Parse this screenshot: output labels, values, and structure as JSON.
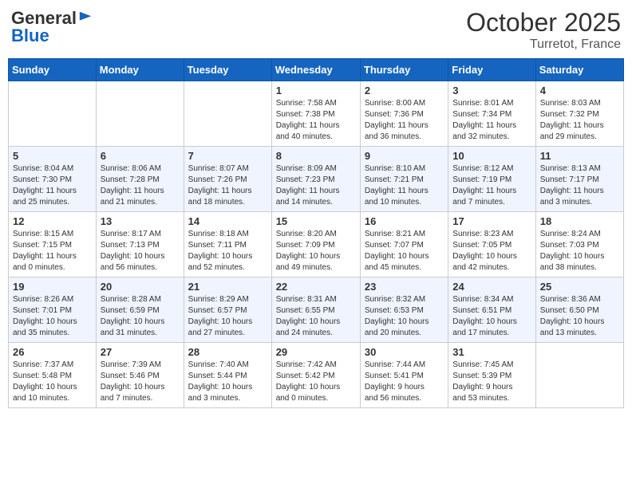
{
  "header": {
    "logo_general": "General",
    "logo_blue": "Blue",
    "month_title": "October 2025",
    "subtitle": "Turretot, France"
  },
  "days_of_week": [
    "Sunday",
    "Monday",
    "Tuesday",
    "Wednesday",
    "Thursday",
    "Friday",
    "Saturday"
  ],
  "weeks": [
    [
      {
        "day": "",
        "info": ""
      },
      {
        "day": "",
        "info": ""
      },
      {
        "day": "",
        "info": ""
      },
      {
        "day": "1",
        "info": "Sunrise: 7:58 AM\nSunset: 7:38 PM\nDaylight: 11 hours\nand 40 minutes."
      },
      {
        "day": "2",
        "info": "Sunrise: 8:00 AM\nSunset: 7:36 PM\nDaylight: 11 hours\nand 36 minutes."
      },
      {
        "day": "3",
        "info": "Sunrise: 8:01 AM\nSunset: 7:34 PM\nDaylight: 11 hours\nand 32 minutes."
      },
      {
        "day": "4",
        "info": "Sunrise: 8:03 AM\nSunset: 7:32 PM\nDaylight: 11 hours\nand 29 minutes."
      }
    ],
    [
      {
        "day": "5",
        "info": "Sunrise: 8:04 AM\nSunset: 7:30 PM\nDaylight: 11 hours\nand 25 minutes."
      },
      {
        "day": "6",
        "info": "Sunrise: 8:06 AM\nSunset: 7:28 PM\nDaylight: 11 hours\nand 21 minutes."
      },
      {
        "day": "7",
        "info": "Sunrise: 8:07 AM\nSunset: 7:26 PM\nDaylight: 11 hours\nand 18 minutes."
      },
      {
        "day": "8",
        "info": "Sunrise: 8:09 AM\nSunset: 7:23 PM\nDaylight: 11 hours\nand 14 minutes."
      },
      {
        "day": "9",
        "info": "Sunrise: 8:10 AM\nSunset: 7:21 PM\nDaylight: 11 hours\nand 10 minutes."
      },
      {
        "day": "10",
        "info": "Sunrise: 8:12 AM\nSunset: 7:19 PM\nDaylight: 11 hours\nand 7 minutes."
      },
      {
        "day": "11",
        "info": "Sunrise: 8:13 AM\nSunset: 7:17 PM\nDaylight: 11 hours\nand 3 minutes."
      }
    ],
    [
      {
        "day": "12",
        "info": "Sunrise: 8:15 AM\nSunset: 7:15 PM\nDaylight: 11 hours\nand 0 minutes."
      },
      {
        "day": "13",
        "info": "Sunrise: 8:17 AM\nSunset: 7:13 PM\nDaylight: 10 hours\nand 56 minutes."
      },
      {
        "day": "14",
        "info": "Sunrise: 8:18 AM\nSunset: 7:11 PM\nDaylight: 10 hours\nand 52 minutes."
      },
      {
        "day": "15",
        "info": "Sunrise: 8:20 AM\nSunset: 7:09 PM\nDaylight: 10 hours\nand 49 minutes."
      },
      {
        "day": "16",
        "info": "Sunrise: 8:21 AM\nSunset: 7:07 PM\nDaylight: 10 hours\nand 45 minutes."
      },
      {
        "day": "17",
        "info": "Sunrise: 8:23 AM\nSunset: 7:05 PM\nDaylight: 10 hours\nand 42 minutes."
      },
      {
        "day": "18",
        "info": "Sunrise: 8:24 AM\nSunset: 7:03 PM\nDaylight: 10 hours\nand 38 minutes."
      }
    ],
    [
      {
        "day": "19",
        "info": "Sunrise: 8:26 AM\nSunset: 7:01 PM\nDaylight: 10 hours\nand 35 minutes."
      },
      {
        "day": "20",
        "info": "Sunrise: 8:28 AM\nSunset: 6:59 PM\nDaylight: 10 hours\nand 31 minutes."
      },
      {
        "day": "21",
        "info": "Sunrise: 8:29 AM\nSunset: 6:57 PM\nDaylight: 10 hours\nand 27 minutes."
      },
      {
        "day": "22",
        "info": "Sunrise: 8:31 AM\nSunset: 6:55 PM\nDaylight: 10 hours\nand 24 minutes."
      },
      {
        "day": "23",
        "info": "Sunrise: 8:32 AM\nSunset: 6:53 PM\nDaylight: 10 hours\nand 20 minutes."
      },
      {
        "day": "24",
        "info": "Sunrise: 8:34 AM\nSunset: 6:51 PM\nDaylight: 10 hours\nand 17 minutes."
      },
      {
        "day": "25",
        "info": "Sunrise: 8:36 AM\nSunset: 6:50 PM\nDaylight: 10 hours\nand 13 minutes."
      }
    ],
    [
      {
        "day": "26",
        "info": "Sunrise: 7:37 AM\nSunset: 5:48 PM\nDaylight: 10 hours\nand 10 minutes."
      },
      {
        "day": "27",
        "info": "Sunrise: 7:39 AM\nSunset: 5:46 PM\nDaylight: 10 hours\nand 7 minutes."
      },
      {
        "day": "28",
        "info": "Sunrise: 7:40 AM\nSunset: 5:44 PM\nDaylight: 10 hours\nand 3 minutes."
      },
      {
        "day": "29",
        "info": "Sunrise: 7:42 AM\nSunset: 5:42 PM\nDaylight: 10 hours\nand 0 minutes."
      },
      {
        "day": "30",
        "info": "Sunrise: 7:44 AM\nSunset: 5:41 PM\nDaylight: 9 hours\nand 56 minutes."
      },
      {
        "day": "31",
        "info": "Sunrise: 7:45 AM\nSunset: 5:39 PM\nDaylight: 9 hours\nand 53 minutes."
      },
      {
        "day": "",
        "info": ""
      }
    ]
  ]
}
